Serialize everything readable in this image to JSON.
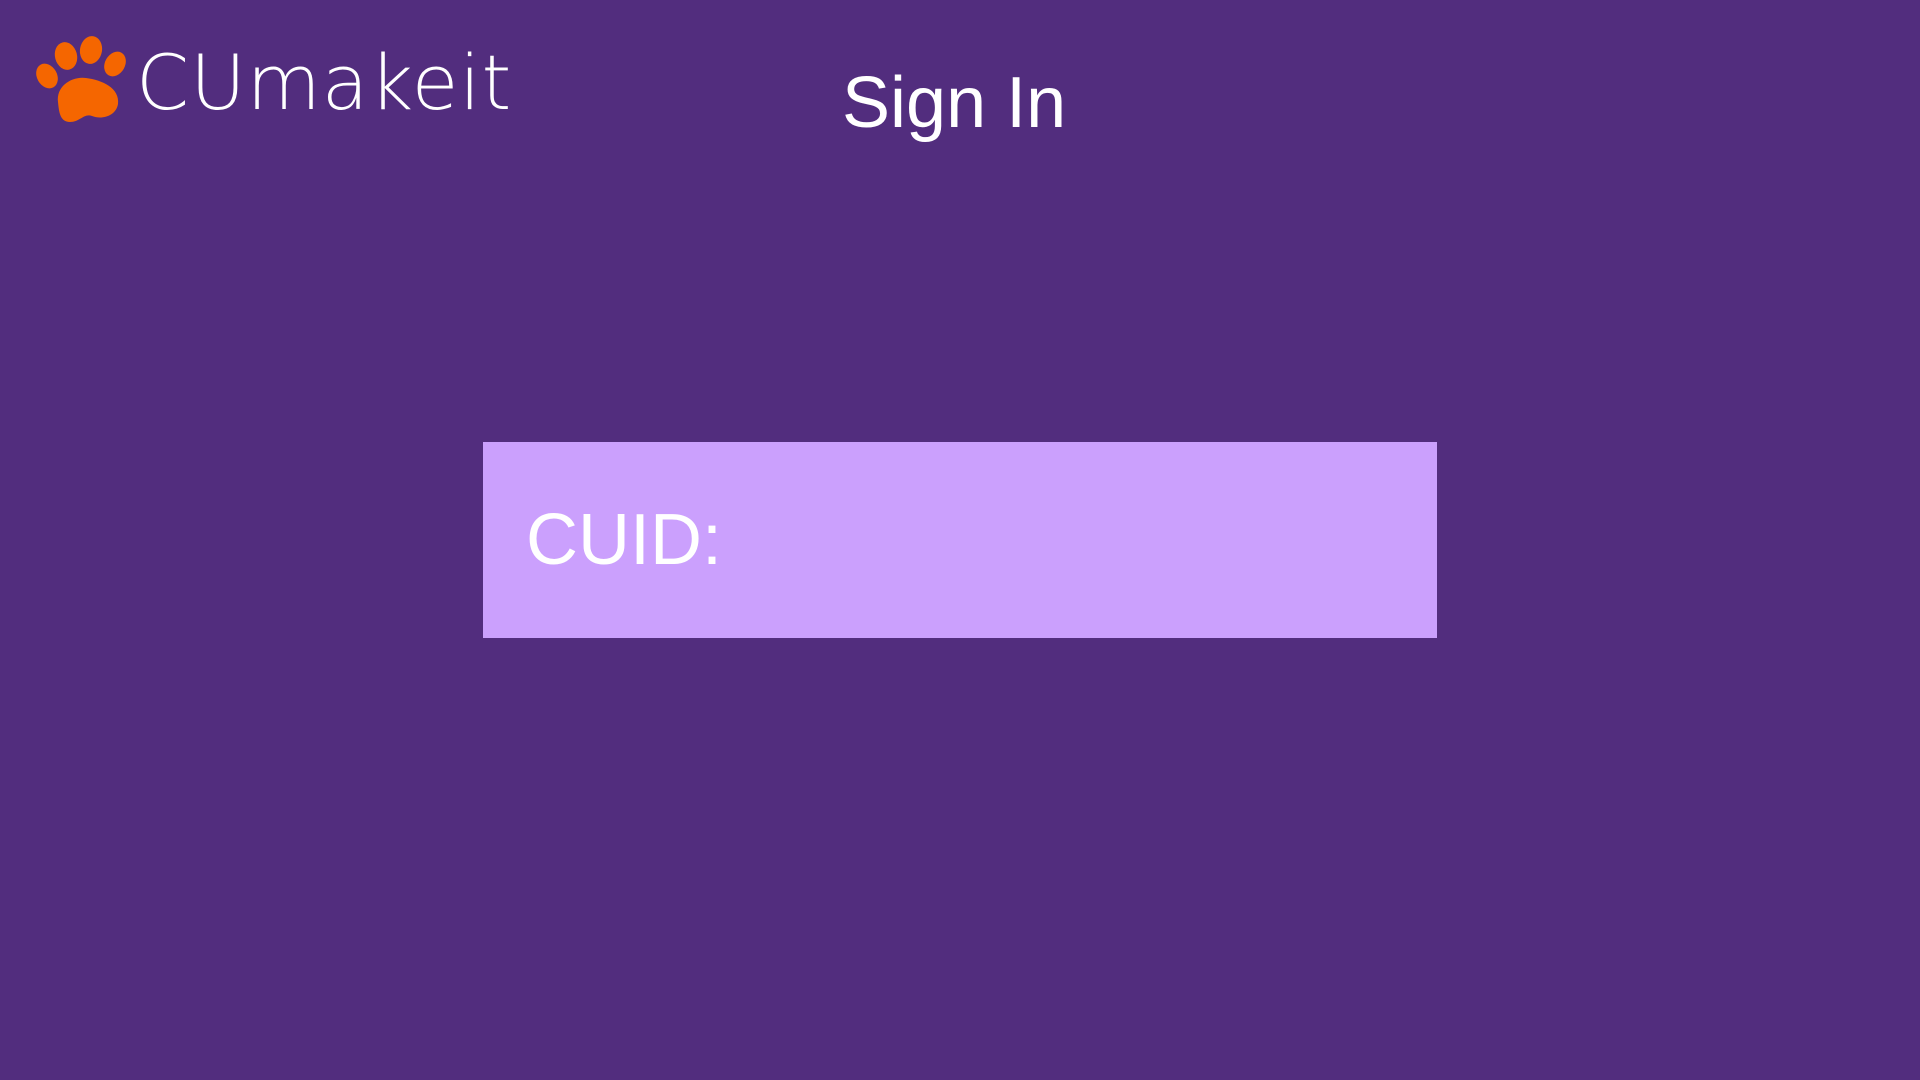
{
  "header": {
    "logo_text": "CUmakeit",
    "logo_icon": "paw-icon",
    "title": "Sign In"
  },
  "form": {
    "cuid_label": "CUID:",
    "cuid_value": "",
    "cuid_placeholder": ""
  },
  "colors": {
    "background": "#522d7e",
    "input_box": "#cba0fd",
    "paw": "#f56600",
    "text": "#ffffff"
  }
}
